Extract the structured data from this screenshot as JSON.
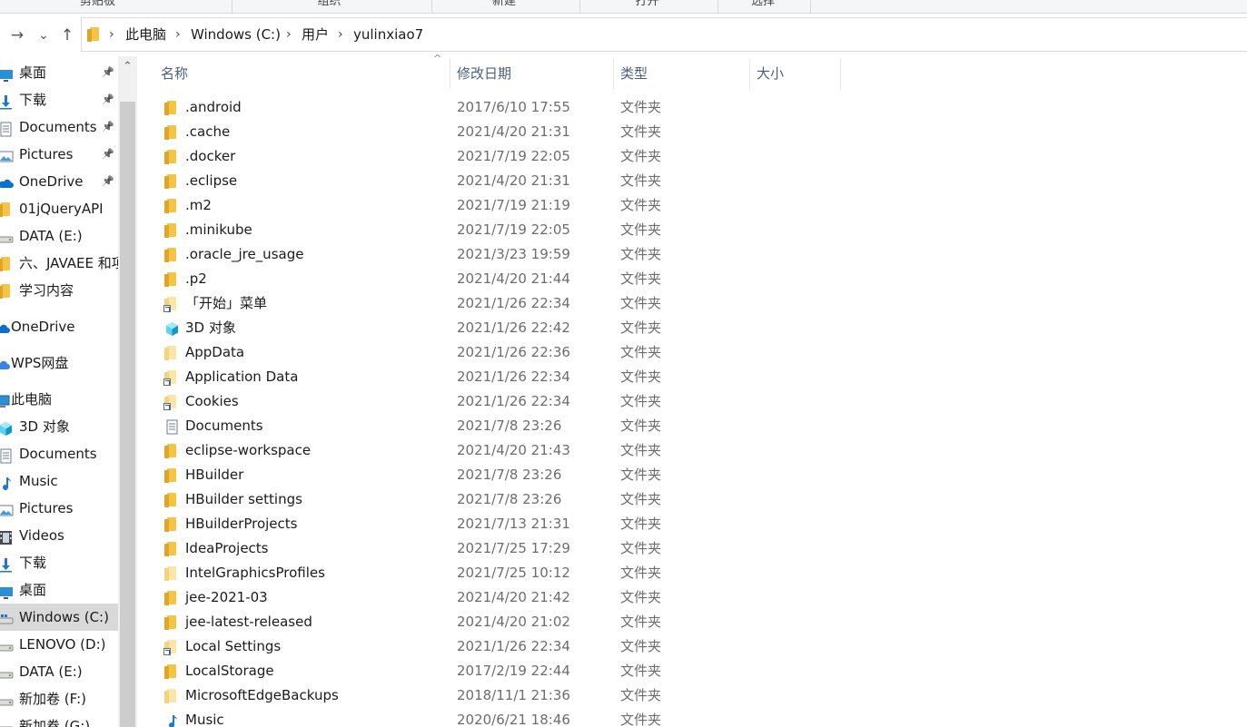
{
  "ribbon": {
    "groups": [
      "剪贴板",
      "组织",
      "新建",
      "打开",
      "选择"
    ]
  },
  "nav": {
    "back_glyph": "→",
    "recent_glyph": "⌄",
    "up_glyph": "↑",
    "breadcrumb": [
      "此电脑",
      "Windows (C:)",
      "用户",
      "yulinxiao7"
    ]
  },
  "sidebar": {
    "items": [
      {
        "label": "桌面",
        "icon": "desktop-icon",
        "pinned": true
      },
      {
        "label": "下载",
        "icon": "download-icon",
        "pinned": true
      },
      {
        "label": "Documents",
        "icon": "documents-icon",
        "pinned": true
      },
      {
        "label": "Pictures",
        "icon": "pictures-icon",
        "pinned": true
      },
      {
        "label": "OneDrive",
        "icon": "onedrive-icon",
        "pinned": true
      },
      {
        "label": "01jQueryAPI",
        "icon": "folder-icon",
        "pinned": false
      },
      {
        "label": "DATA (E:)",
        "icon": "drive-icon",
        "pinned": false
      },
      {
        "label": "六、JAVAEE 和项",
        "icon": "folder-icon",
        "pinned": false
      },
      {
        "label": "学习内容",
        "icon": "folder-icon",
        "pinned": false
      },
      {
        "label": "OneDrive",
        "icon": "onedrive-icon",
        "pinned": false,
        "gap": true
      },
      {
        "label": "WPS网盘",
        "icon": "wps-icon",
        "pinned": false,
        "gap": true
      },
      {
        "label": "此电脑",
        "icon": "computer-icon",
        "pinned": false,
        "gap": true
      },
      {
        "label": "3D 对象",
        "icon": "3d-objects-icon",
        "pinned": false
      },
      {
        "label": "Documents",
        "icon": "documents-icon",
        "pinned": false
      },
      {
        "label": "Music",
        "icon": "music-icon",
        "pinned": false
      },
      {
        "label": "Pictures",
        "icon": "pictures-icon",
        "pinned": false
      },
      {
        "label": "Videos",
        "icon": "videos-icon",
        "pinned": false
      },
      {
        "label": "下载",
        "icon": "download-icon",
        "pinned": false
      },
      {
        "label": "桌面",
        "icon": "desktop-icon",
        "pinned": false
      },
      {
        "label": "Windows (C:)",
        "icon": "windows-drive-icon",
        "pinned": false,
        "selected": true
      },
      {
        "label": "LENOVO (D:)",
        "icon": "drive-icon",
        "pinned": false
      },
      {
        "label": "DATA (E:)",
        "icon": "drive-icon",
        "pinned": false
      },
      {
        "label": "新加卷 (F:)",
        "icon": "drive-icon",
        "pinned": false
      },
      {
        "label": "新加卷 (G:)",
        "icon": "drive-icon",
        "pinned": false
      }
    ]
  },
  "columns": {
    "name": "名称",
    "date": "修改日期",
    "type": "类型",
    "size": "大小"
  },
  "files": [
    {
      "name": ".android",
      "date": "2017/6/10 17:55",
      "type": "文件夹",
      "icon": "folder-icon"
    },
    {
      "name": ".cache",
      "date": "2021/4/20 21:31",
      "type": "文件夹",
      "icon": "folder-icon"
    },
    {
      "name": ".docker",
      "date": "2021/7/19 22:05",
      "type": "文件夹",
      "icon": "folder-icon"
    },
    {
      "name": ".eclipse",
      "date": "2021/4/20 21:31",
      "type": "文件夹",
      "icon": "folder-icon"
    },
    {
      "name": ".m2",
      "date": "2021/7/19 21:19",
      "type": "文件夹",
      "icon": "folder-icon"
    },
    {
      "name": ".minikube",
      "date": "2021/7/19 22:05",
      "type": "文件夹",
      "icon": "folder-icon"
    },
    {
      "name": ".oracle_jre_usage",
      "date": "2021/3/23 19:59",
      "type": "文件夹",
      "icon": "folder-icon"
    },
    {
      "name": ".p2",
      "date": "2021/4/20 21:44",
      "type": "文件夹",
      "icon": "folder-icon"
    },
    {
      "name": "「开始」菜单",
      "date": "2021/1/26 22:34",
      "type": "文件夹",
      "icon": "shortcut-folder-icon"
    },
    {
      "name": "3D 对象",
      "date": "2021/1/26 22:42",
      "type": "文件夹",
      "icon": "3d-objects-icon"
    },
    {
      "name": "AppData",
      "date": "2021/1/26 22:36",
      "type": "文件夹",
      "icon": "hidden-folder-icon"
    },
    {
      "name": "Application Data",
      "date": "2021/1/26 22:34",
      "type": "文件夹",
      "icon": "shortcut-folder-icon"
    },
    {
      "name": "Cookies",
      "date": "2021/1/26 22:34",
      "type": "文件夹",
      "icon": "shortcut-folder-icon"
    },
    {
      "name": "Documents",
      "date": "2021/7/8 23:26",
      "type": "文件夹",
      "icon": "documents-icon"
    },
    {
      "name": "eclipse-workspace",
      "date": "2021/4/20 21:43",
      "type": "文件夹",
      "icon": "folder-icon"
    },
    {
      "name": "HBuilder",
      "date": "2021/7/8 23:26",
      "type": "文件夹",
      "icon": "folder-icon"
    },
    {
      "name": "HBuilder settings",
      "date": "2021/7/8 23:26",
      "type": "文件夹",
      "icon": "folder-icon"
    },
    {
      "name": "HBuilderProjects",
      "date": "2021/7/13 21:31",
      "type": "文件夹",
      "icon": "folder-icon"
    },
    {
      "name": "IdeaProjects",
      "date": "2021/7/25 17:29",
      "type": "文件夹",
      "icon": "folder-icon"
    },
    {
      "name": "IntelGraphicsProfiles",
      "date": "2021/7/25 10:12",
      "type": "文件夹",
      "icon": "hidden-folder-icon"
    },
    {
      "name": "jee-2021-03",
      "date": "2021/4/20 21:42",
      "type": "文件夹",
      "icon": "folder-icon"
    },
    {
      "name": "jee-latest-released",
      "date": "2021/4/20 21:02",
      "type": "文件夹",
      "icon": "folder-icon"
    },
    {
      "name": "Local Settings",
      "date": "2021/1/26 22:34",
      "type": "文件夹",
      "icon": "shortcut-folder-icon"
    },
    {
      "name": "LocalStorage",
      "date": "2017/2/19 22:44",
      "type": "文件夹",
      "icon": "folder-icon"
    },
    {
      "name": "MicrosoftEdgeBackups",
      "date": "2018/11/1 21:36",
      "type": "文件夹",
      "icon": "hidden-folder-icon"
    },
    {
      "name": "Music",
      "date": "2020/6/21 18:46",
      "type": "文件夹",
      "icon": "music-icon"
    }
  ]
}
